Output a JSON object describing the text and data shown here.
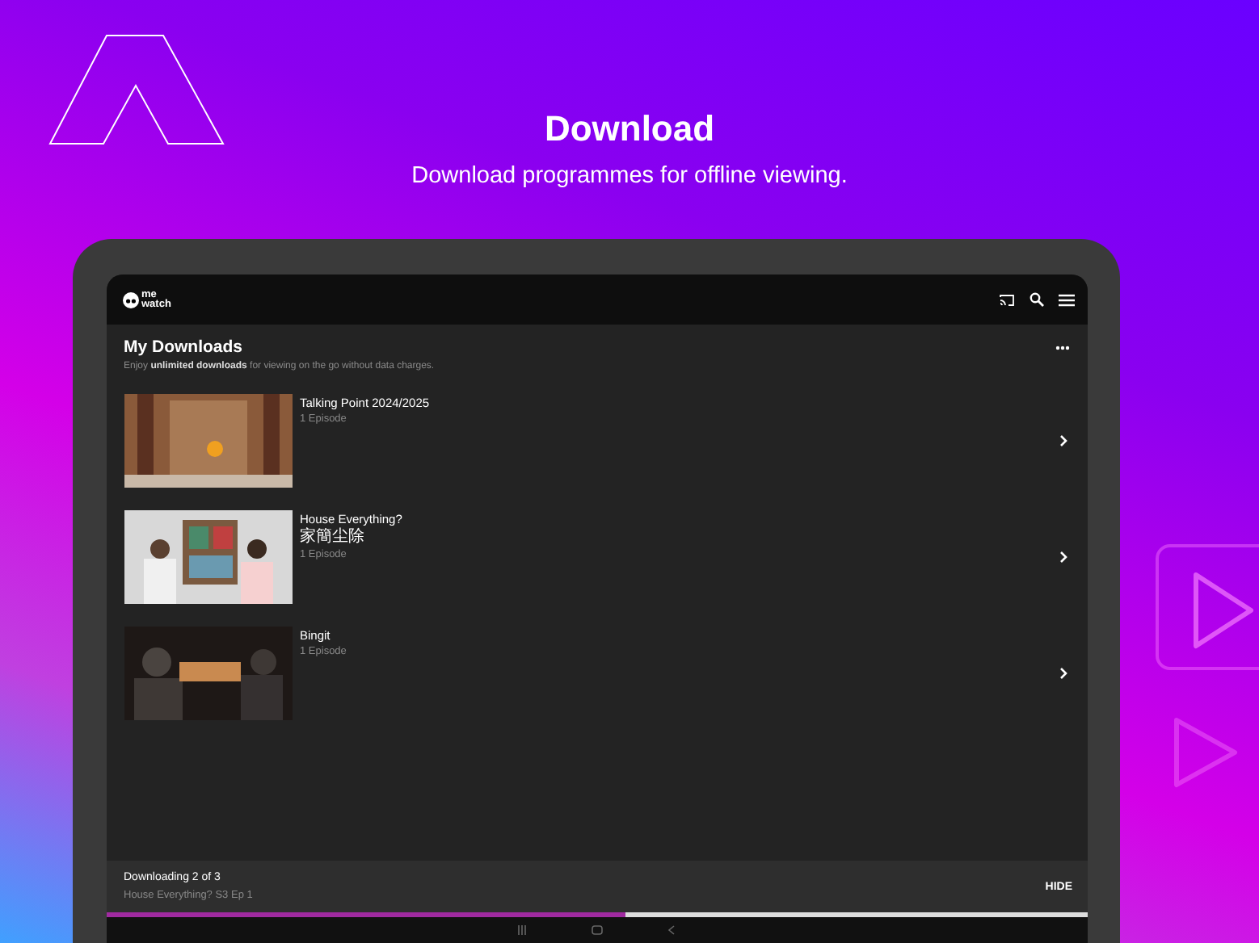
{
  "promo": {
    "title": "Download",
    "subtitle": "Download programmes for offline viewing."
  },
  "app": {
    "logo_lines": [
      "me",
      "watch"
    ]
  },
  "page": {
    "title": "My Downloads",
    "description": "Enjoy **unlimited downloads** for viewing on the go without data charges."
  },
  "downloads": [
    {
      "title": "Talking Point 2024/2025",
      "episodes": "1 Episode"
    },
    {
      "title": "House Everything?",
      "subtitle": "家簡尘除",
      "episodes": "1 Episode"
    },
    {
      "title": "Bingit",
      "episodes": "1 Episode"
    }
  ],
  "download_bar": {
    "status": "Downloading 2 of 3",
    "item": "House Everything? S3 Ep 1",
    "action": "HIDE",
    "level": 0.53
  }
}
